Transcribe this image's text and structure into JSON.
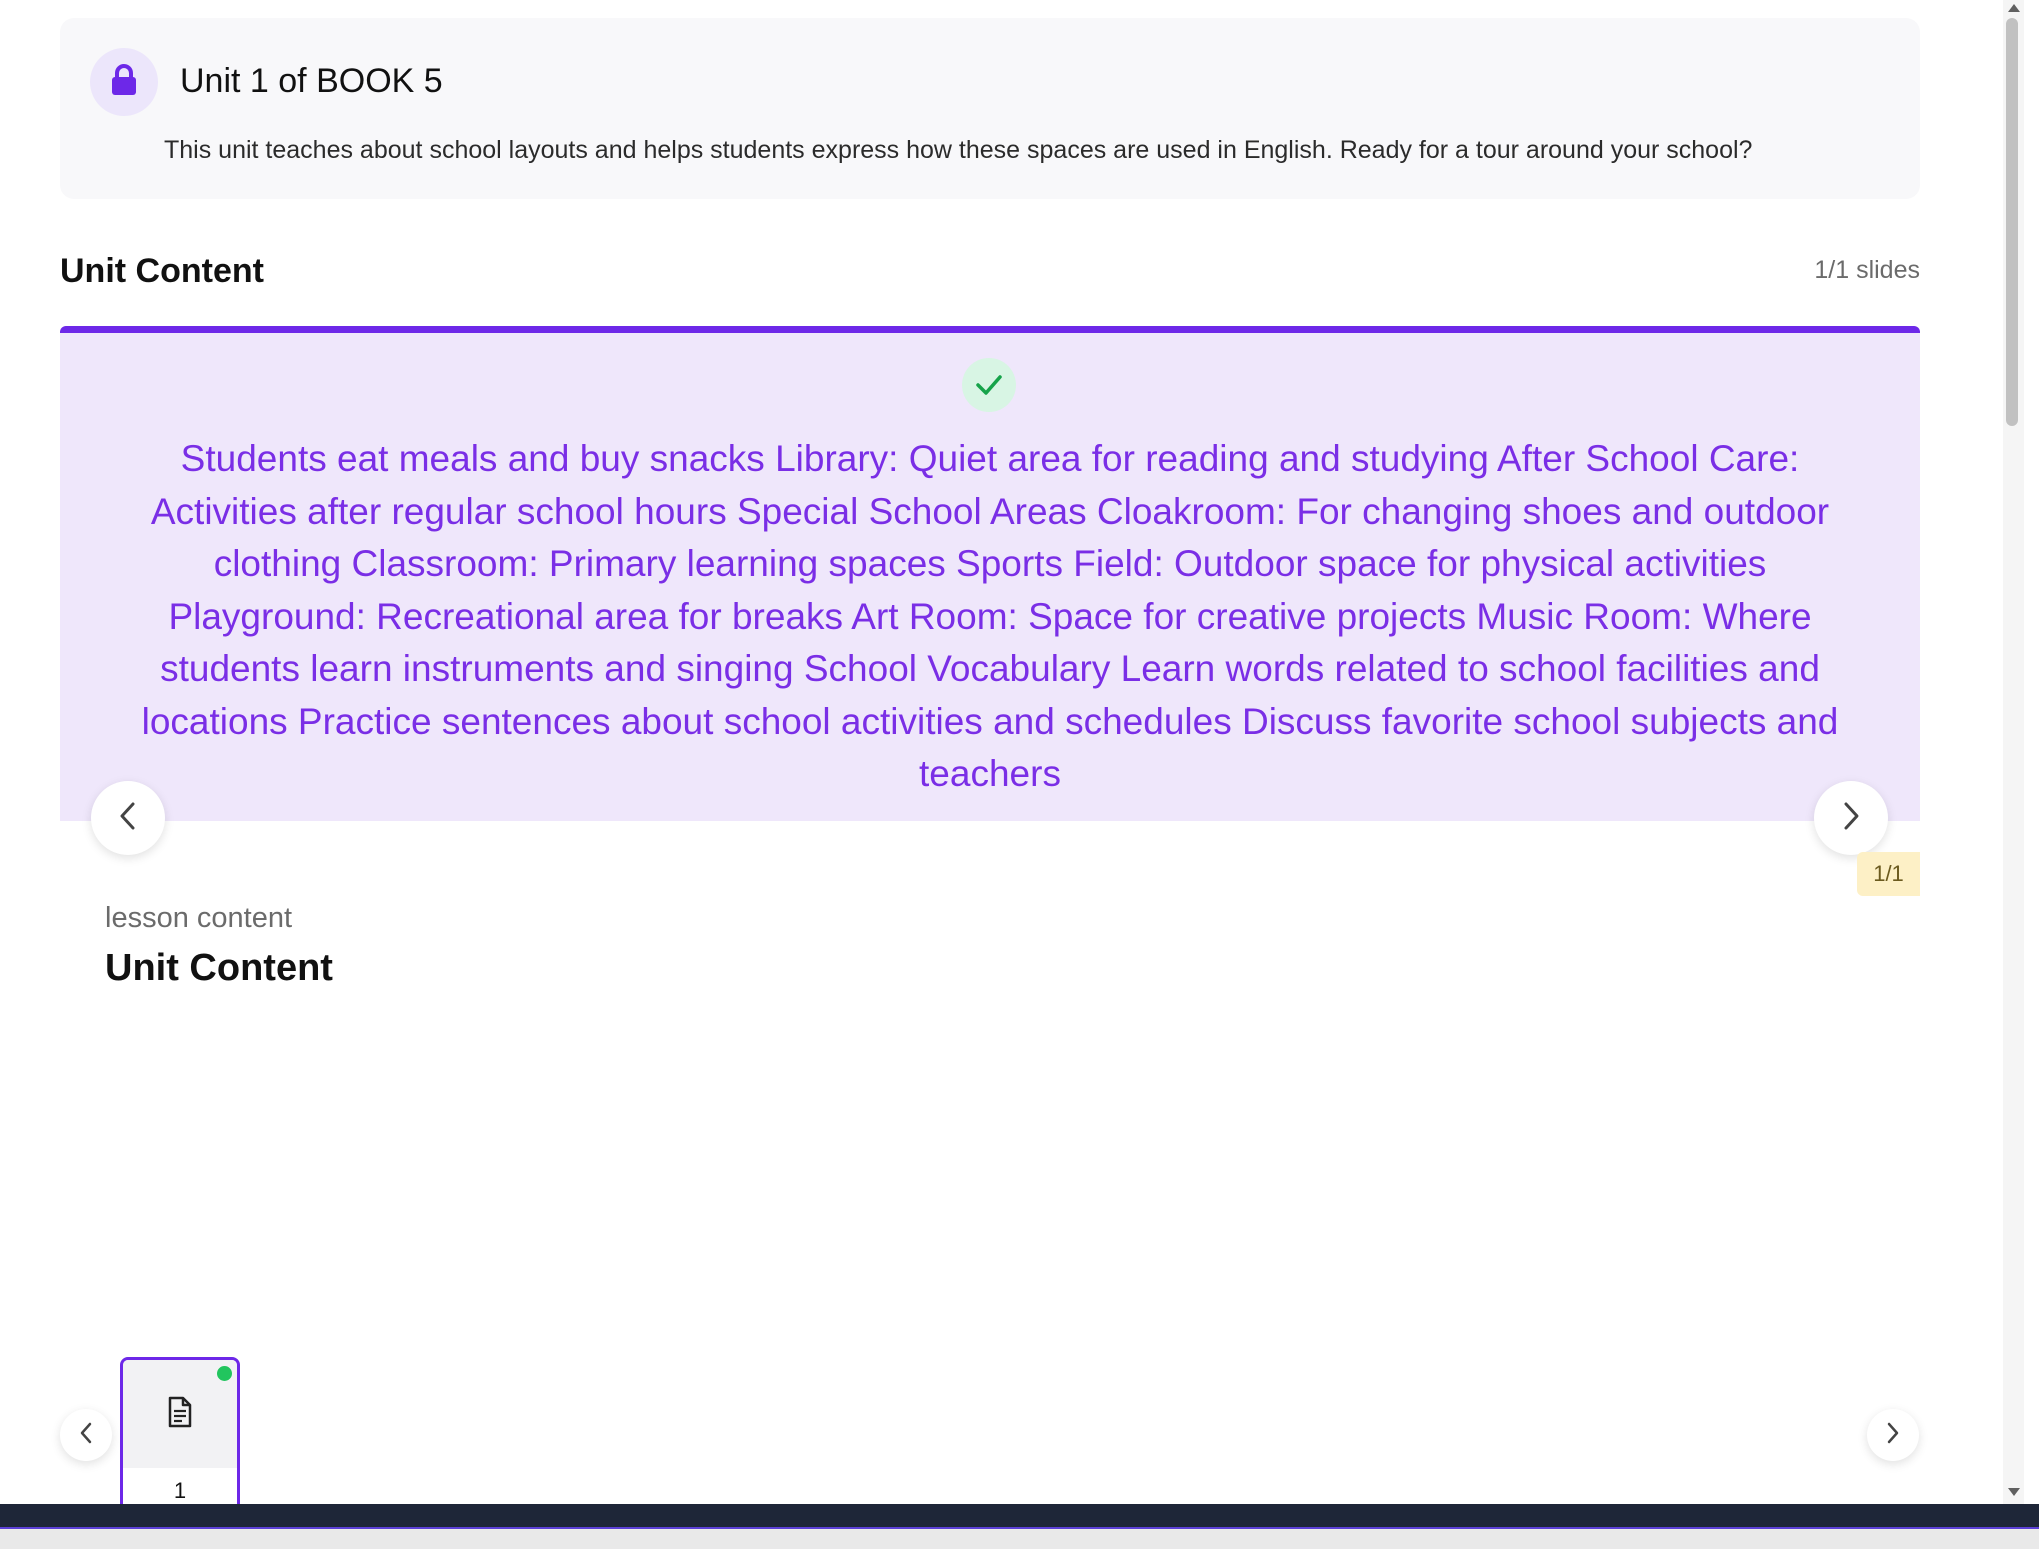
{
  "unit": {
    "title": "Unit 1 of BOOK 5",
    "description": "This unit teaches about school layouts and helps students express how these spaces are used in English. Ready for a tour around your school?",
    "icon": "lock-icon"
  },
  "section": {
    "title": "Unit Content",
    "slides_count": "1/1 slides"
  },
  "slide": {
    "status_icon": "check-icon",
    "text": "Students eat meals and buy snacks Library: Quiet area for reading and studying After School Care: Activities after regular school hours Special School Areas Cloakroom: For changing shoes and outdoor clothing Classroom: Primary learning spaces Sports Field: Outdoor space for physical activities Playground: Recreational area for breaks Art Room: Space for creative projects Music Room: Where students learn instruments and singing School Vocabulary Learn words related to school facilities and locations Practice sentences about school activities and schedules Discuss favorite school subjects and teachers",
    "page_badge": "1/1"
  },
  "lesson": {
    "label": "lesson content",
    "title": "Unit Content"
  },
  "thumbnails": [
    {
      "number": "1",
      "icon": "document-icon",
      "completed": true
    }
  ],
  "colors": {
    "accent": "#6d28e8",
    "slide_bg": "#efe7fb",
    "slide_text": "#7a2ee6",
    "success": "#22c55e",
    "badge_bg": "#fdf0c6"
  }
}
